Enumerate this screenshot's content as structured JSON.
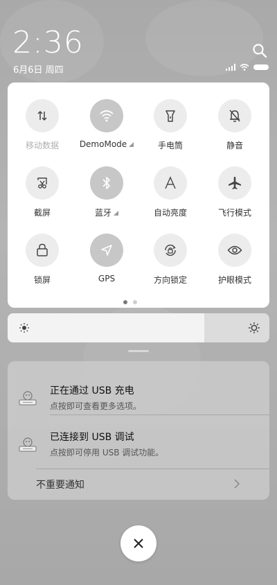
{
  "status_bar": {
    "time": "2:36",
    "date": "6月6日 周四"
  },
  "quick_settings": {
    "tiles": [
      {
        "label": "移动数据",
        "icon": "mobile-data-icon",
        "active": false,
        "disabled": true
      },
      {
        "label": "DemoMode",
        "icon": "wifi-icon",
        "active": true,
        "has_more": true
      },
      {
        "label": "手电筒",
        "icon": "flashlight-icon",
        "active": false
      },
      {
        "label": "静音",
        "icon": "bell-off-icon",
        "active": false
      },
      {
        "label": "截屏",
        "icon": "screenshot-icon",
        "active": false
      },
      {
        "label": "蓝牙",
        "icon": "bluetooth-icon",
        "active": true,
        "has_more": true
      },
      {
        "label": "自动亮度",
        "icon": "auto-brightness-icon",
        "active": false
      },
      {
        "label": "飞行模式",
        "icon": "airplane-icon",
        "active": false
      },
      {
        "label": "锁屏",
        "icon": "lock-icon",
        "active": false
      },
      {
        "label": "GPS",
        "icon": "location-icon",
        "active": true
      },
      {
        "label": "方向锁定",
        "icon": "rotation-lock-icon",
        "active": false
      },
      {
        "label": "护眼模式",
        "icon": "eye-icon",
        "active": false
      }
    ],
    "page_count": 2,
    "current_page": 1
  },
  "brightness": {
    "level": 0.75
  },
  "notifications": {
    "items": [
      {
        "title": "正在通过 USB 充电",
        "text": "点按即可查看更多选项。"
      },
      {
        "title": "已连接到 USB 调试",
        "text": "点按即可停用 USB 调试功能。"
      }
    ],
    "unimportant_label": "不重要通知"
  },
  "colors": {
    "tile_on": "#c7c7c7",
    "tile_off": "#ececec",
    "panel": "#ffffff"
  }
}
